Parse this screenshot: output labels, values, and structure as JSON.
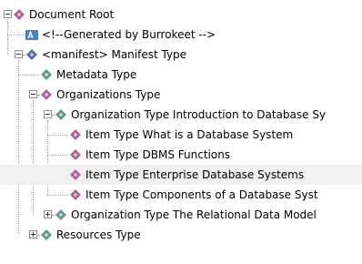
{
  "tree": {
    "nodes": [
      {
        "label": "Document Root",
        "depth": 0,
        "toggle": "minus",
        "icon": "pink-diamond-icon"
      },
      {
        "label": "<!--Generated by Burrokeet -->",
        "depth": 1,
        "toggle": "none",
        "icon": "comment-icon"
      },
      {
        "label": "<manifest> Manifest Type",
        "depth": 1,
        "toggle": "minus",
        "icon": "blue-diamond-icon"
      },
      {
        "label": "Metadata Type",
        "depth": 2,
        "toggle": "none",
        "icon": "teal-diamond-icon"
      },
      {
        "label": "Organizations Type",
        "depth": 2,
        "toggle": "minus",
        "icon": "pink-diamond-icon"
      },
      {
        "label": "Organization Type Introduction to Database Sy",
        "depth": 3,
        "toggle": "minus",
        "icon": "teal-diamond-icon"
      },
      {
        "label": "Item Type What is a Database System",
        "depth": 4,
        "toggle": "none",
        "icon": "pink-diamond-icon"
      },
      {
        "label": "Item Type DBMS Functions",
        "depth": 4,
        "toggle": "none",
        "icon": "pink-diamond-icon"
      },
      {
        "label": "Item Type Enterprise Database Systems",
        "depth": 4,
        "toggle": "none",
        "icon": "pink-diamond-icon",
        "selected": true
      },
      {
        "label": "Item Type Components of a Database Syst",
        "depth": 4,
        "toggle": "none",
        "icon": "pink-diamond-icon"
      },
      {
        "label": "Organization Type The Relational Data Model",
        "depth": 3,
        "toggle": "plus",
        "icon": "teal-diamond-icon"
      },
      {
        "label": "Resources Type",
        "depth": 2,
        "toggle": "plus",
        "icon": "teal-diamond-icon"
      }
    ]
  },
  "colors": {
    "pink_diamond": "#b4609a",
    "blue_diamond": "#5a6fa8",
    "teal_diamond": "#5f9a93",
    "comment_icon": "#4a7fc1",
    "selection": "#f1f1f1"
  }
}
